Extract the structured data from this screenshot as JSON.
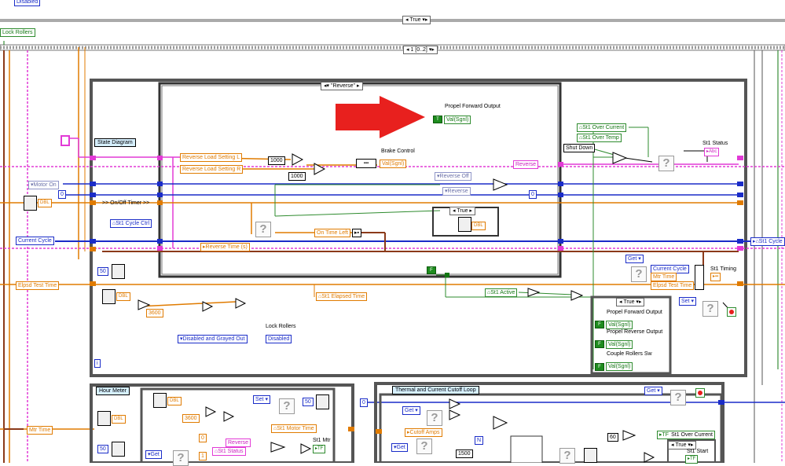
{
  "colors": {
    "orange": "#e07b00",
    "pink": "#e23ad6",
    "blue": "#1a2cc8",
    "green": "#2e8b2e",
    "frame": "#555555",
    "arrow": "#e8201e"
  },
  "top": {
    "disabled_label": "Disabled",
    "case_true": "True",
    "lock_rollers": "Lock Rollers",
    "sequence": "1 [0..2]"
  },
  "frame1": {
    "state_diagram": "State Diagram",
    "motor_on": "Motor On",
    "zero": "0",
    "on_off_timer": ">> On/Off Timer >>",
    "st1_cycle_ctrl": "St1 Cycle Ctrl",
    "current_cycle": "Current Cycle",
    "num50": "50",
    "elpsd_test_time": "Elpsd Test Time",
    "num3600": "3600",
    "dbl": "DBL",
    "mtr_time": "Mtr Time",
    "disabled_grayed": "Disabled and Grayed Out",
    "lock_rollers": "Lock Rollers",
    "disabled": "Disabled",
    "st1_elapsed_time": "St1 Elapsed Time",
    "info": "i"
  },
  "case_reverse": {
    "selector": "\"Reverse\"",
    "propel_forward_output": "Propel Forward Output",
    "val_sgnl": "Val(Sgnl)",
    "rev_load_l": "Reverse Load Setting L",
    "rev_load_r": "Reverse Load Setting R",
    "num1000a": "1000",
    "num1000b": "1000",
    "brake_control": "Brake Control",
    "reverse_off": "Reverse Off",
    "reverse": "Reverse",
    "true_label": "True",
    "on_time_left": "On Time Left",
    "reverse_time": "Reverse Time (s)"
  },
  "right": {
    "reverse_const": "Reverse",
    "st1_over_current": "St1 Over Current",
    "st1_over_temp": "St1 Over Temp",
    "shut_down": "Shut Down",
    "st1_status": "St1 Status",
    "st1_cycle": "St1 Cycle",
    "zero": "0",
    "get": "Get",
    "set": "Set",
    "current_cycle": "Current Cycle",
    "mtr_time": "Mtr Time",
    "elpsd_test_time": "Elpsd Test Time",
    "st1_timing": "St1 Timing",
    "st1_active": "St1 Active",
    "true_label": "True",
    "propel_forward_output": "Propel Forward Output",
    "propel_reverse_output": "Propel Reverse Output",
    "couple_rollers_sw": "Couple Rollers Sw",
    "val_sgnl": "Val(Sgnl)",
    "f": "F"
  },
  "hour_meter": {
    "title": "Hour Meter",
    "num3600": "3600",
    "zero": "0",
    "num1": "1",
    "reverse": "Reverse",
    "st1_status": "St1 Status",
    "st1_mtr": "St1 Mtr",
    "st1_motor_time": "St1 Motor Time",
    "set": "Set",
    "get": "Get",
    "num50": "50",
    "mtr_time": "Mtr Time"
  },
  "thermal": {
    "title": "Thermal and Current Cutoff Loop",
    "zero": "0",
    "get": "Get",
    "cutoff_amps": "Cutoff Amps",
    "num1500": "1500",
    "n": "N",
    "num60": "60",
    "st1_over_current": "St1 Over Current",
    "true_label": "True",
    "st1_start": "St1 Start"
  }
}
